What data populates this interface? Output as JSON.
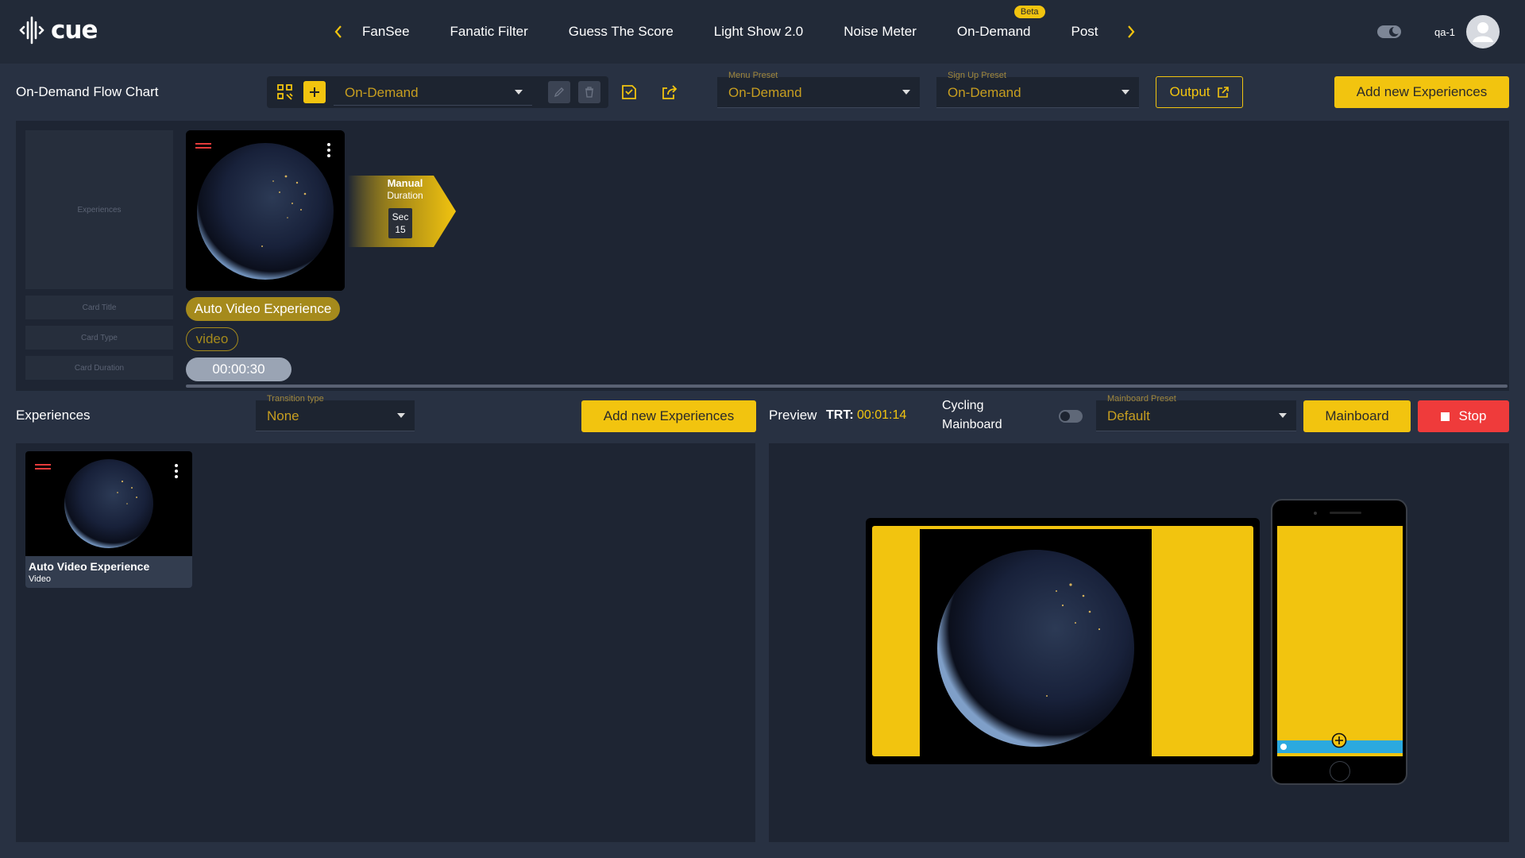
{
  "brand": {
    "logo_text": "cue"
  },
  "nav": {
    "tabs": [
      {
        "label": "FanSee"
      },
      {
        "label": "Fanatic Filter"
      },
      {
        "label": "Guess The Score"
      },
      {
        "label": "Light Show 2.0"
      },
      {
        "label": "Noise Meter"
      },
      {
        "label": "On-Demand",
        "badge": "Beta"
      },
      {
        "label": "Post"
      }
    ],
    "prev_icon": "chevron-left-icon",
    "next_icon": "chevron-right-icon"
  },
  "user": {
    "name": "qa-1",
    "theme_toggle_icon": "theme-toggle-icon"
  },
  "flow_toolbar": {
    "title": "On-Demand Flow Chart",
    "flow_select": {
      "value": "On-Demand"
    },
    "menu_preset": {
      "label": "Menu Preset",
      "value": "On-Demand"
    },
    "signup_preset": {
      "label": "Sign Up Preset",
      "value": "On-Demand"
    },
    "output_button": "Output",
    "add_button": "Add new Experiences"
  },
  "flow_chart": {
    "row_labels": {
      "experiences": "Experiences",
      "card_title": "Card Title",
      "card_type": "Card Type",
      "card_duration": "Card Duration"
    },
    "card": {
      "title": "Auto Video Experience",
      "type": "video",
      "duration": "00:00:30"
    },
    "transition": {
      "mode": "Manual",
      "label": "Duration",
      "unit": "Sec",
      "value": "15"
    }
  },
  "experiences_bar": {
    "title": "Experiences",
    "transition_type": {
      "label": "Transition type",
      "value": "None"
    },
    "add_button": "Add new Experiences",
    "preview_label": "Preview",
    "trt_label": "TRT:",
    "trt_value": "00:01:14",
    "cycling_label_line1": "Cycling",
    "cycling_label_line2": "Mainboard",
    "mainboard_preset": {
      "label": "Mainboard Preset",
      "value": "Default"
    },
    "mainboard_button": "Mainboard",
    "stop_button": "Stop"
  },
  "experience_list": [
    {
      "title": "Auto Video Experience",
      "type": "Video"
    }
  ],
  "colors": {
    "accent": "#f2c40f",
    "background": "#283142",
    "panel": "#1e2533",
    "stop": "#ef3b3b"
  }
}
